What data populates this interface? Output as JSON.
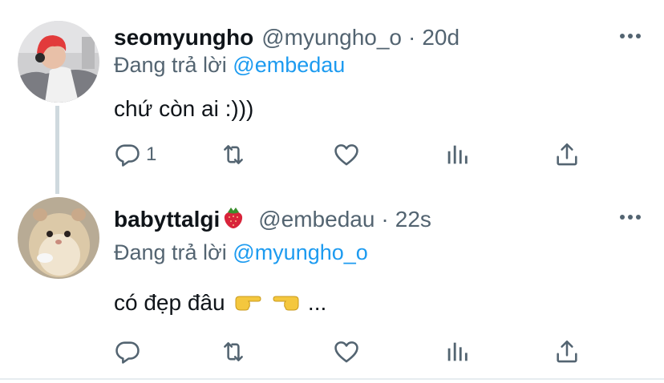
{
  "tweets": [
    {
      "name": "seomyungho",
      "handle": "@myungho_o",
      "separator": "·",
      "time": "20d",
      "replying_prefix": "Đang trả lời",
      "replying_to": "@embedau",
      "text": "chứ còn ai :)))",
      "reply_count": "1"
    },
    {
      "name": "babyttalgi",
      "name_emoji": "strawberry-icon",
      "handle": "@embedau",
      "separator": "·",
      "time": "22s",
      "replying_prefix": "Đang trả lời",
      "replying_to": "@myungho_o",
      "text_before": "có đẹp đâu",
      "text_emoji_1": "backhand-index-pointing-right-icon",
      "text_emoji_2": "backhand-index-pointing-left-icon",
      "text_after": "...",
      "reply_count": ""
    }
  ],
  "icons": {
    "reply": "reply-icon",
    "retweet": "retweet-icon",
    "like": "heart-icon",
    "analytics": "analytics-icon",
    "share": "share-icon",
    "more": "more-icon"
  },
  "colors": {
    "text": "#0f1419",
    "secondary": "#536471",
    "mention": "#1d9bf0",
    "thread_line": "#cfd9de"
  }
}
